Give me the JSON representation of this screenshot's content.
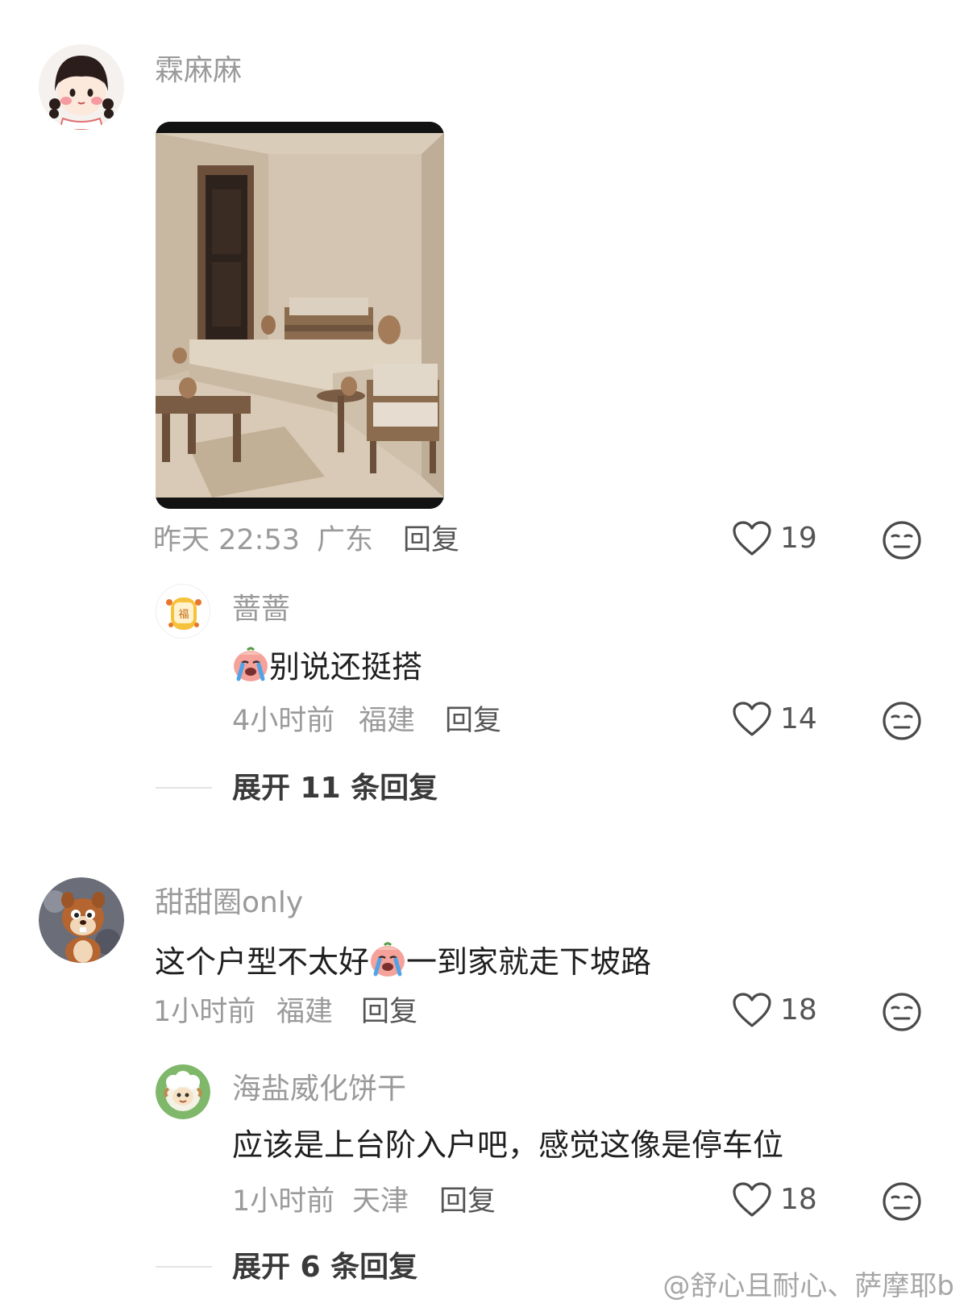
{
  "comments": [
    {
      "username": "霖麻麻",
      "time": "昨天 22:53",
      "location": "广东",
      "reply_label": "回复",
      "likes": "19",
      "has_image": true,
      "replies": [
        {
          "username": "蔷蔷",
          "text": "别说还挺搭",
          "time": "4小时前",
          "location": "福建",
          "reply_label": "回复",
          "likes": "14"
        }
      ],
      "expand_label": "展开 11 条回复"
    },
    {
      "username": "甜甜圈only",
      "text_before_emoji": "这个户型不太好",
      "text_after_emoji": "一到家就走下坡路",
      "time": "1小时前",
      "location": "福建",
      "reply_label": "回复",
      "likes": "18",
      "replies": [
        {
          "username": "海盐威化饼干",
          "text": "应该是上台阶入户吧，感觉这像是停车位",
          "time": "1小时前",
          "location": "天津",
          "reply_label": "回复",
          "likes": "18"
        }
      ],
      "expand_label": "展开 6 条回复"
    }
  ],
  "watermark": "@舒心且耐心、萨摩耶b",
  "icons": {
    "like": "heart-outline-icon",
    "dislike": "meh-face-icon",
    "emoji": "crying-face-emoji"
  },
  "colors": {
    "meta_text": "#9a9a9a",
    "body_text": "#1f1f1f",
    "icon_stroke": "#4a4a4a"
  }
}
